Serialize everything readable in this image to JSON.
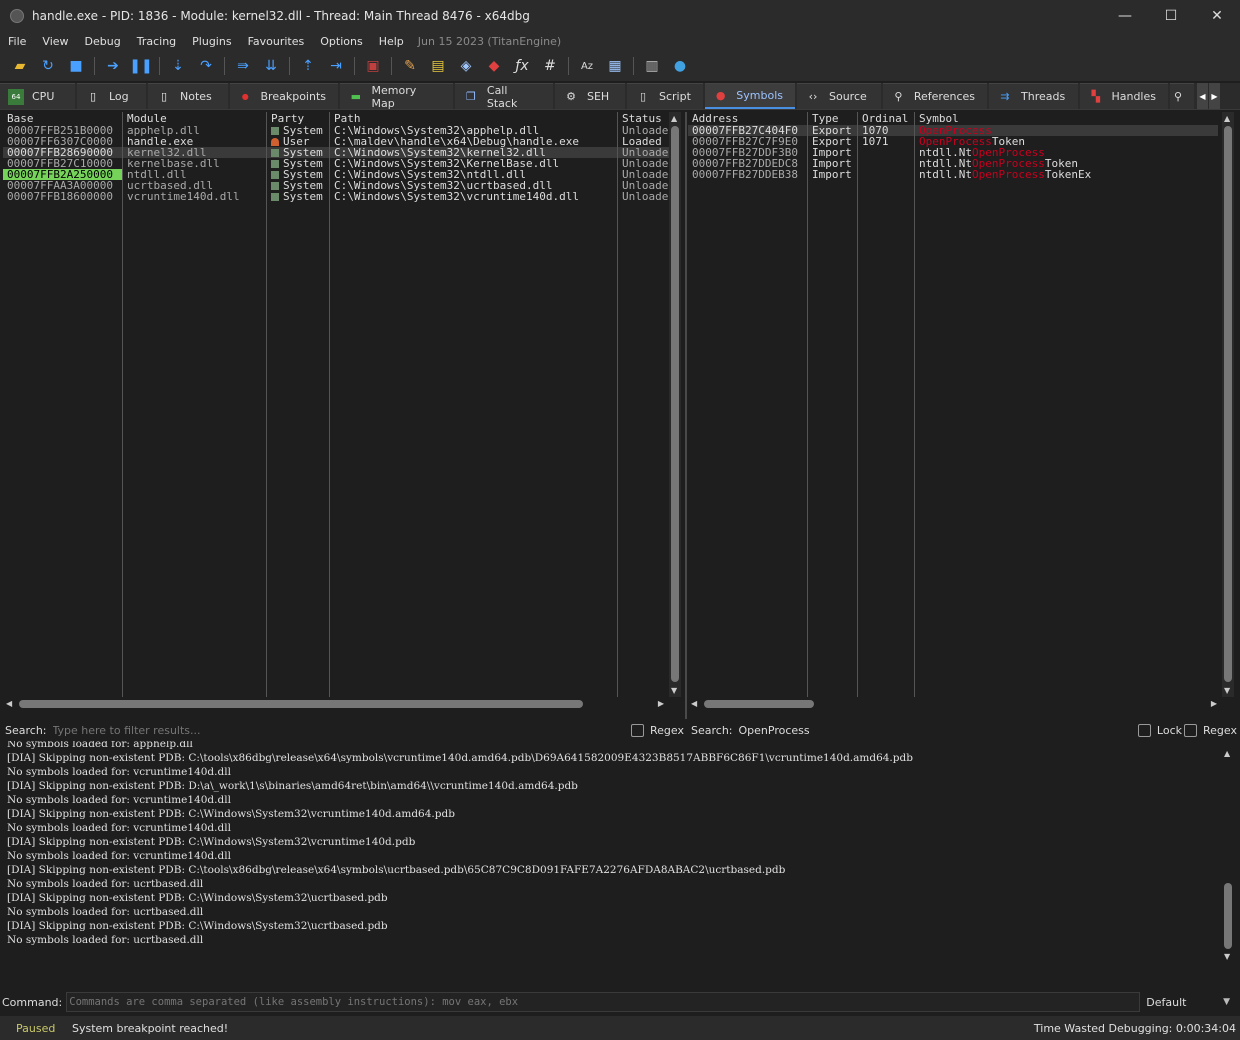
{
  "window": {
    "title": "handle.exe - PID: 1836 - Module: kernel32.dll - Thread: Main Thread 8476 - x64dbg",
    "buttons": {
      "minimize": "—",
      "maximize": "☐",
      "close": "✕"
    }
  },
  "menu": {
    "items": [
      "File",
      "View",
      "Debug",
      "Tracing",
      "Plugins",
      "Favourites",
      "Options",
      "Help"
    ],
    "date": "Jun 15 2023 (TitanEngine)"
  },
  "toolbar": {
    "icons": [
      "open-icon",
      "restart-icon",
      "stop-icon",
      "run-icon",
      "pause-icon",
      "step-into-icon",
      "step-over-icon",
      "trace-into-icon",
      "trace-over-icon",
      "execute-till-return-icon",
      "run-to-user-code-icon",
      "scylla-icon",
      "patch-icon",
      "comment-icon",
      "label-icon",
      "bookmark-icon",
      "function-icon",
      "hash-icon",
      "strings-icon",
      "calls-icon",
      "calculator-icon",
      "help-globe-icon"
    ]
  },
  "tabs": [
    {
      "label": "CPU",
      "icon": "cpu-icon"
    },
    {
      "label": "Log",
      "icon": "log-icon"
    },
    {
      "label": "Notes",
      "icon": "notes-icon"
    },
    {
      "label": "Breakpoints",
      "icon": "breakpoint-icon"
    },
    {
      "label": "Memory Map",
      "icon": "memory-icon"
    },
    {
      "label": "Call Stack",
      "icon": "callstack-icon"
    },
    {
      "label": "SEH",
      "icon": "seh-icon"
    },
    {
      "label": "Script",
      "icon": "script-icon"
    },
    {
      "label": "Symbols",
      "icon": "symbols-icon",
      "active": true
    },
    {
      "label": "Source",
      "icon": "source-icon"
    },
    {
      "label": "References",
      "icon": "references-icon"
    },
    {
      "label": "Threads",
      "icon": "threads-icon"
    },
    {
      "label": "Handles",
      "icon": "handles-icon"
    }
  ],
  "modules": {
    "columns": [
      "Base",
      "Module",
      "Party",
      "Path",
      "Status"
    ],
    "rows": [
      {
        "base": "00007FFB251B0000",
        "module": "apphelp.dll",
        "party": "System",
        "path": "C:\\Windows\\System32\\apphelp.dll",
        "status": "Unloade"
      },
      {
        "base": "00007FF6307C0000",
        "module": "handle.exe",
        "party": "User",
        "path": "C:\\maldev\\handle\\x64\\Debug\\handle.exe",
        "status": "Loaded"
      },
      {
        "base": "00007FFB28690000",
        "module": "kernel32.dll",
        "party": "System",
        "path": "C:\\Windows\\System32\\kernel32.dll",
        "status": "Unloade"
      },
      {
        "base": "00007FFB27C10000",
        "module": "kernelbase.dll",
        "party": "System",
        "path": "C:\\Windows\\System32\\KernelBase.dll",
        "status": "Unloade"
      },
      {
        "base": "00007FFB2A250000",
        "module": "ntdll.dll",
        "party": "System",
        "path": "C:\\Windows\\System32\\ntdll.dll",
        "status": "Unloade"
      },
      {
        "base": "00007FFAA3A00000",
        "module": "ucrtbased.dll",
        "party": "System",
        "path": "C:\\Windows\\System32\\ucrtbased.dll",
        "status": "Unloade"
      },
      {
        "base": "00007FFB18600000",
        "module": "vcruntime140d.dll",
        "party": "System",
        "path": "C:\\Windows\\System32\\vcruntime140d.dll",
        "status": "Unloade"
      }
    ],
    "search_label": "Search:",
    "search_placeholder": "Type here to filter results...",
    "regex_label": "Regex"
  },
  "symbols": {
    "columns": [
      "Address",
      "Type",
      "Ordinal",
      "Symbol"
    ],
    "rows": [
      {
        "address": "00007FFB27C404F0",
        "type": "Export",
        "ordinal": "1070",
        "prefix": "",
        "match": "OpenProcess",
        "suffix": ""
      },
      {
        "address": "00007FFB27C7F9E0",
        "type": "Export",
        "ordinal": "1071",
        "prefix": "",
        "match": "OpenProcess",
        "suffix": "Token"
      },
      {
        "address": "00007FFB27DDF3B0",
        "type": "Import",
        "ordinal": "",
        "prefix": "ntdll.Nt",
        "match": "OpenProcess",
        "suffix": ""
      },
      {
        "address": "00007FFB27DDEDC8",
        "type": "Import",
        "ordinal": "",
        "prefix": "ntdll.Nt",
        "match": "OpenProcess",
        "suffix": "Token"
      },
      {
        "address": "00007FFB27DDEB38",
        "type": "Import",
        "ordinal": "",
        "prefix": "ntdll.Nt",
        "match": "OpenProcess",
        "suffix": "TokenEx"
      }
    ],
    "search_label": "Search:",
    "search_value": "OpenProcess",
    "lock_label": "Lock",
    "regex_label": "Regex"
  },
  "log": {
    "lines": [
      "No symbols loaded for: apphelp.dll",
      "[DIA] Skipping non-existent PDB: C:\\tools\\x86dbg\\release\\x64\\symbols\\vcruntime140d.amd64.pdb\\D69A641582009E4323B8517ABBF6C86F1\\vcruntime140d.amd64.pdb",
      "No symbols loaded for: vcruntime140d.dll",
      "[DIA] Skipping non-existent PDB: D:\\a\\_work\\1\\s\\binaries\\amd64ret\\bin\\amd64\\\\vcruntime140d.amd64.pdb",
      "No symbols loaded for: vcruntime140d.dll",
      "[DIA] Skipping non-existent PDB: C:\\Windows\\System32\\vcruntime140d.amd64.pdb",
      "No symbols loaded for: vcruntime140d.dll",
      "[DIA] Skipping non-existent PDB: C:\\Windows\\System32\\vcruntime140d.pdb",
      "No symbols loaded for: vcruntime140d.dll",
      "[DIA] Skipping non-existent PDB: C:\\tools\\x86dbg\\release\\x64\\symbols\\ucrtbased.pdb\\65C87C9C8D091FAFE7A2276AFDA8ABAC2\\ucrtbased.pdb",
      "No symbols loaded for: ucrtbased.dll",
      "[DIA] Skipping non-existent PDB: C:\\Windows\\System32\\ucrtbased.pdb",
      "No symbols loaded for: ucrtbased.dll",
      "[DIA] Skipping non-existent PDB: C:\\Windows\\System32\\ucrtbased.pdb",
      "No symbols loaded for: ucrtbased.dll"
    ]
  },
  "command": {
    "label": "Command:",
    "placeholder": "Commands are comma separated (like assembly instructions): mov eax, ebx",
    "mode": "Default"
  },
  "status": {
    "state": "Paused",
    "message": "System breakpoint reached!",
    "time_wasted": "Time Wasted Debugging: 0:00:34:04"
  }
}
